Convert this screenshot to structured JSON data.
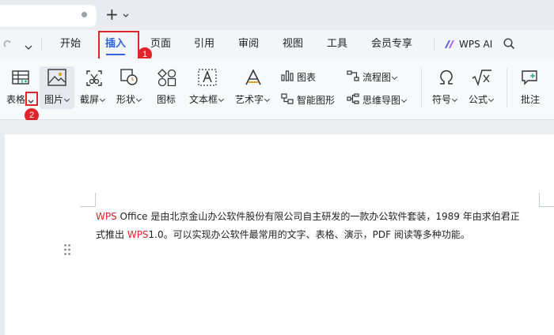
{
  "tabbar": {
    "new_tab_symbol": "+"
  },
  "menu": {
    "items": [
      "开始",
      "插入",
      "页面",
      "引用",
      "审阅",
      "视图",
      "工具",
      "会员专享"
    ],
    "active": "插入",
    "ai_label": "WPS AI"
  },
  "ribbon": {
    "table": "表格",
    "picture": "图片",
    "screenshot": "截屏",
    "shape": "形状",
    "icon": "图标",
    "textbox": "文本框",
    "wordart": "艺术字",
    "chart": "图表",
    "smartart": "智能图形",
    "flowchart": "流程图",
    "mindmap": "思维导图",
    "symbol": "符号",
    "formula": "公式",
    "comment": "批注"
  },
  "callouts": {
    "step1": "1",
    "step2": "2"
  },
  "document": {
    "line1_brand": "WPS",
    "line1_text": " Office 是由北京金山办公软件股份有限公司自主研发的一款办公软件套装，1989 年由求伯君正",
    "line2_prefix": "式推出 ",
    "line2_brand": "WPS",
    "line2_text": "1.0。可以实现办公软件最常用的文字、表格、演示，PDF 阅读等多种功能。"
  },
  "colors": {
    "accent": "#2f65e0",
    "highlight_red": "#e0242a"
  }
}
